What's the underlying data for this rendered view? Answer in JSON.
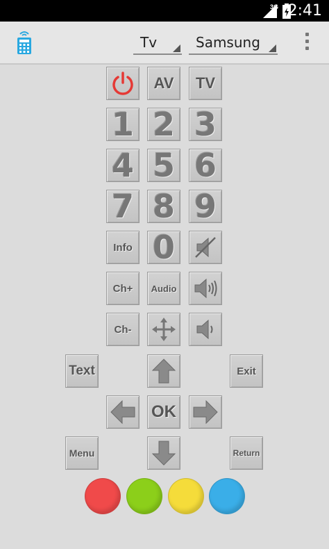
{
  "status_bar": {
    "network": "3G",
    "time": "2:41"
  },
  "action_bar": {
    "device_type": "Tv",
    "brand": "Samsung"
  },
  "remote": {
    "av": "AV",
    "tv": "TV",
    "digits": [
      "1",
      "2",
      "3",
      "4",
      "5",
      "6",
      "7",
      "8",
      "9",
      "0"
    ],
    "info": "Info",
    "ch_up": "Ch+",
    "audio": "Audio",
    "ch_down": "Ch-",
    "text": "Text",
    "exit": "Exit",
    "ok": "OK",
    "menu": "Menu",
    "return": "Return"
  },
  "colors": {
    "power": "#e53935",
    "red": "#f04a4a",
    "green": "#8ccf1a",
    "yellow": "#f5dc3a",
    "blue": "#3aaee8"
  }
}
